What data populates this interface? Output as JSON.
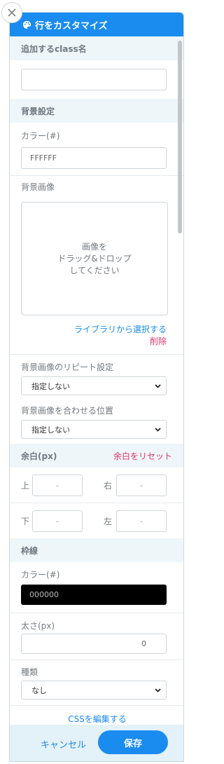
{
  "header": {
    "title": "行をカスタマイズ",
    "icon": "palette-icon"
  },
  "class_section": {
    "title": "追加するclass名",
    "value": ""
  },
  "background": {
    "title": "背景設定",
    "color_label": "カラー(#)",
    "color_value": "FFFFFF",
    "image_label": "背景画像",
    "dropzone_line1": "画像を",
    "dropzone_line2": "ドラッグ&ドロップ",
    "dropzone_line3": "してください",
    "library_link": "ライブラリから選択する",
    "delete_link": "削除",
    "repeat_label": "背景画像のリピート設定",
    "repeat_value": "指定しない",
    "position_label": "背景画像を合わせる位置",
    "position_value": "指定しない"
  },
  "margin": {
    "title": "余白(px)",
    "reset_label": "余白をリセット",
    "top_label": "上",
    "top_value": "-",
    "right_label": "右",
    "right_value": "-",
    "bottom_label": "下",
    "bottom_value": "-",
    "left_label": "左",
    "left_value": "-"
  },
  "border": {
    "title": "枠線",
    "color_label": "カラー(#)",
    "color_value": "000000",
    "width_label": "太さ(px)",
    "width_value": "0",
    "type_label": "種類",
    "type_value": "なし"
  },
  "edit_css_link": "CSSを編集する",
  "footer": {
    "cancel_label": "キャンセル",
    "save_label": "保存"
  },
  "colors": {
    "accent": "#1a8cf0",
    "danger": "#e0336c",
    "section_bg": "#eef6f9",
    "footer_bg": "#e3f1f8"
  }
}
